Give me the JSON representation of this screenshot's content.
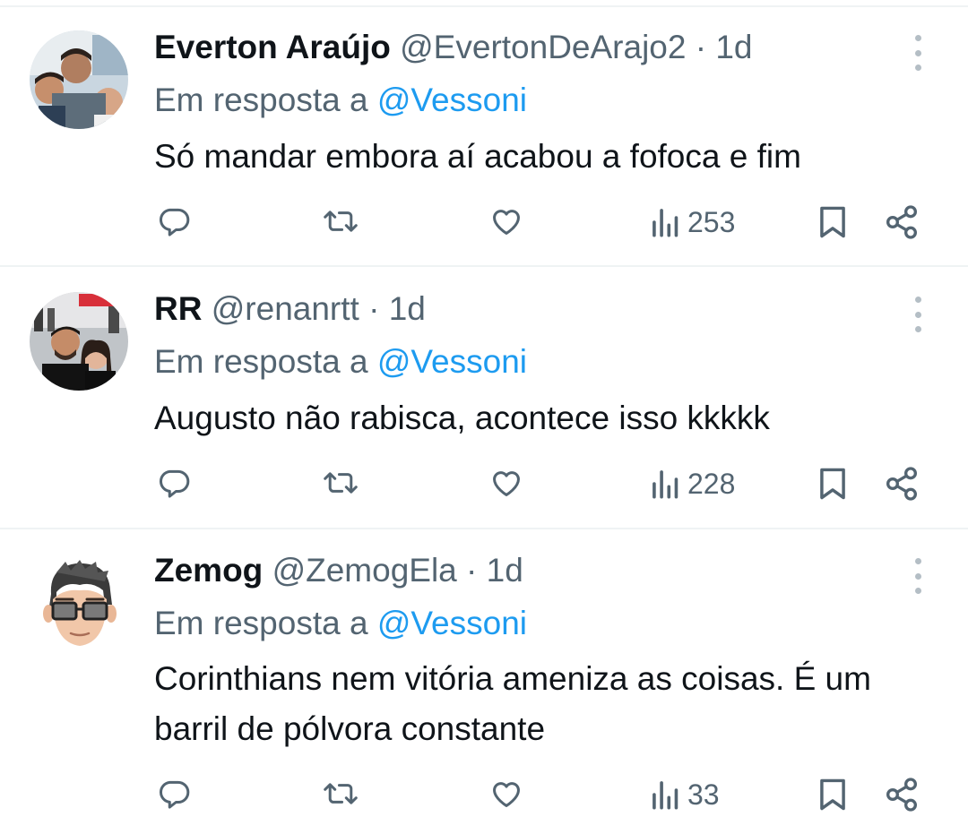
{
  "colors": {
    "accent": "#1d9bf0",
    "secondary_text": "#536471",
    "divider": "#eff3f4"
  },
  "actions_icons": [
    "reply-icon",
    "retweet-icon",
    "like-icon",
    "views-icon",
    "bookmark-icon",
    "share-icon"
  ],
  "tweets": [
    {
      "name": "Everton Araújo",
      "handle": "@EvertonDeArajo2",
      "separator": "·",
      "time": "1d",
      "reply_prefix": "Em resposta a",
      "reply_to": "@Vessoni",
      "text": "Só mandar embora aí acabou a fofoca e fim",
      "views": "253"
    },
    {
      "name": "RR",
      "handle": "@renanrtt",
      "separator": "·",
      "time": "1d",
      "reply_prefix": "Em resposta a",
      "reply_to": "@Vessoni",
      "text": "Augusto não rabisca, acontece isso kkkkk",
      "views": "228"
    },
    {
      "name": "Zemog",
      "handle": "@ZemogEla",
      "separator": "·",
      "time": "1d",
      "reply_prefix": "Em resposta a",
      "reply_to": "@Vessoni",
      "text": "Corinthians nem vitória ameniza as coisas. É um barril de pólvora constante",
      "views": "33"
    }
  ]
}
